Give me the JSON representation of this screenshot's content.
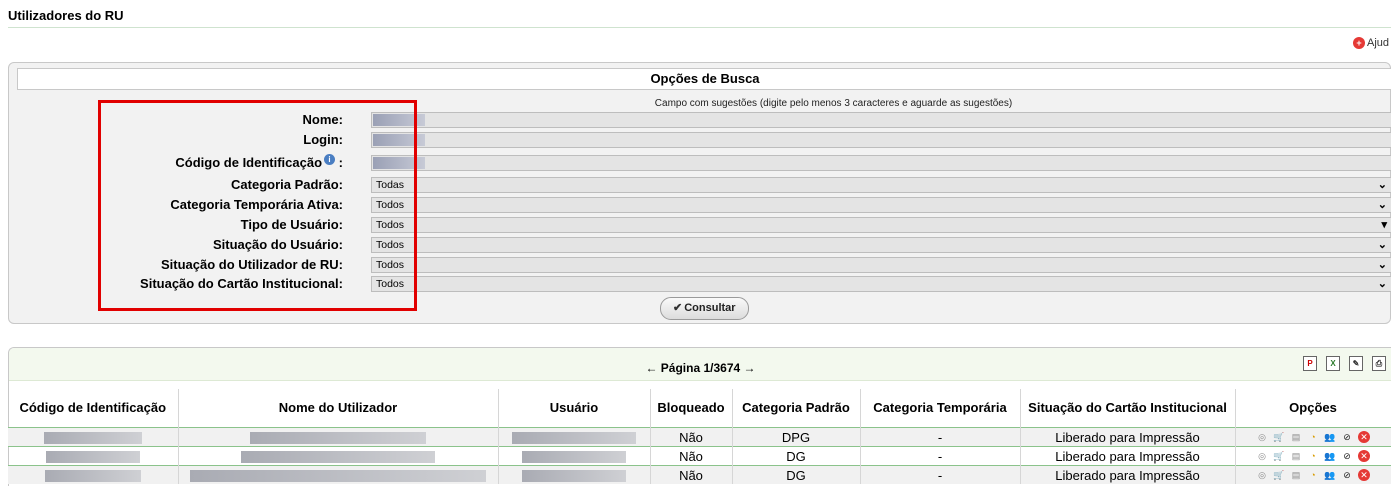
{
  "page": {
    "title": "Utilizadores do RU",
    "help_label": "Ajud"
  },
  "search": {
    "title": "Opções de Busca",
    "hint": "Campo com sugestões (digite pelo menos 3 caracteres e aguarde as sugestões)",
    "fields": {
      "nome": "Nome:",
      "login": "Login:",
      "codigo": "Código de Identificação",
      "codigo_suffix": ":",
      "categoria_padrao": "Categoria Padrão:",
      "categoria_temp": "Categoria Temporária Ativa:",
      "tipo_usuario": "Tipo de Usuário:",
      "situacao_usuario": "Situação do Usuário:",
      "situacao_utilizador": "Situação do Utilizador de RU:",
      "situacao_cartao": "Situação do Cartão Institucional:"
    },
    "values": {
      "categoria_padrao": "Todas",
      "categoria_temp": "Todos",
      "tipo_usuario": "Todos",
      "situacao_usuario": "Todos",
      "situacao_utilizador": "Todos",
      "situacao_cartao": "Todos"
    },
    "button": "Consultar"
  },
  "results": {
    "pager": "← Página 1/3674 →",
    "columns": {
      "codigo": "Código de Identificação",
      "nome": "Nome do Utilizador",
      "usuario": "Usuário",
      "bloqueado": "Bloqueado",
      "cat_padrao": "Categoria Padrão",
      "cat_temp": "Categoria Temporária",
      "situacao": "Situação do Cartão Institucional",
      "opcoes": "Opções"
    },
    "rows": [
      {
        "bloqueado": "Não",
        "categoria": "DPG",
        "temporaria": "-",
        "situacao": "Liberado para Impressão"
      },
      {
        "bloqueado": "Não",
        "categoria": "DG",
        "temporaria": "-",
        "situacao": "Liberado para Impressão"
      },
      {
        "bloqueado": "Não",
        "categoria": "DG",
        "temporaria": "-",
        "situacao": "Liberado para Impressão"
      }
    ]
  },
  "colors": {
    "highlight": "#e10000",
    "pager_bg": "#f3f9ee",
    "row_rule": "#8bc38b"
  },
  "icons": [
    "help-icon",
    "info-icon",
    "pdf-icon",
    "excel-icon",
    "edit-icon",
    "print-icon",
    "view-icon",
    "cart-icon",
    "card-icon",
    "chart-icon",
    "users-icon",
    "block-icon",
    "delete-icon"
  ]
}
